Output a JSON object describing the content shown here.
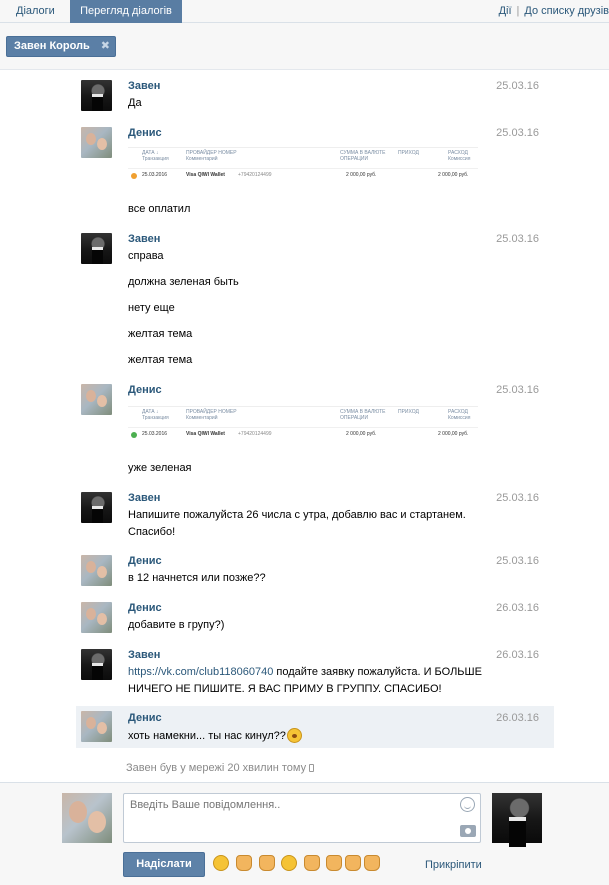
{
  "tabs": [
    "Діалоги",
    "Перегляд діалогів"
  ],
  "top_links": {
    "actions": "Дії",
    "separator": "|",
    "to_friends": "До списку друзів"
  },
  "filter_chip": {
    "label": "Завен Король",
    "close": "✖"
  },
  "messages": [
    {
      "author": "Завен",
      "date": "25.03.16",
      "lines": [
        "Да"
      ]
    },
    {
      "author": "Денис",
      "date": "25.03.16",
      "lines": [
        "все оплатил"
      ],
      "payment": {
        "h_date": "ДАТА ↓",
        "h_date2": "Транзакция",
        "h_provider": "ПРОВАЙДЕР НОМЕР",
        "h_provider2": "Комментарий",
        "h_sum": "СУММА В ВАЛЮТЕ",
        "h_sum2": "ОПЕРАЦИИ",
        "h_in": "ПРИХОД",
        "h_out": "РАСХОД",
        "h_out2": "Комиссия",
        "date": "25.03.2016",
        "provider": "Visa QIWI Wallet",
        "number": "+79420124499",
        "sum": "2 000,00 руб.",
        "out": "2 000,00 руб.",
        "status_color": "#f0a030"
      }
    },
    {
      "author": "Завен",
      "date": "25.03.16",
      "lines": [
        "справа",
        "должна зеленая быть",
        "нету еще",
        "желтая тема",
        "желтая тема"
      ]
    },
    {
      "author": "Денис",
      "date": "25.03.16",
      "lines": [
        "уже зеленая"
      ],
      "payment": {
        "h_date": "ДАТА ↓",
        "h_date2": "Транзакция",
        "h_provider": "ПРОВАЙДЕР НОМЕР",
        "h_provider2": "Комментарий",
        "h_sum": "СУММА В ВАЛЮТЕ",
        "h_sum2": "ОПЕРАЦИИ",
        "h_in": "ПРИХОД",
        "h_out": "РАСХОД",
        "h_out2": "Комиссия",
        "date": "25.03.2016",
        "provider": "Visa QIWI Wallet",
        "number": "+79420124499",
        "sum": "2 000,00 руб.",
        "out": "2 000,00 руб.",
        "status_color": "#4caf50"
      }
    },
    {
      "author": "Завен",
      "date": "25.03.16",
      "lines": [
        "Напишите пожалуйста 26 числа с утра, добавлю вас и стартанем.",
        "Спасибо!"
      ]
    },
    {
      "author": "Денис",
      "date": "25.03.16",
      "lines": [
        "в 12 начнется или позже??"
      ]
    },
    {
      "author": "Денис",
      "date": "26.03.16",
      "lines": [
        "добавите в групу?)"
      ]
    },
    {
      "author": "Завен",
      "date": "26.03.16",
      "link": "https://vk.com/club118060740",
      "link_rest": " подайте заявку пожалуйста. И БОЛЬШЕ",
      "lines": [
        "НИЧЕГО НЕ ПИШИТЕ. Я ВАС ПРИМУ В ГРУППУ. СПАСИБО!"
      ]
    },
    {
      "author": "Денис",
      "date": "26.03.16",
      "lines": [
        "хоть намекни... ты нас кинул??"
      ]
    }
  ],
  "status_line": "Завен був у мережі 20 хвилин тому",
  "composer": {
    "placeholder": "Введіть Ваше повідомлення..",
    "send_label": "Надіслати",
    "attach_label": "Прикріпити"
  },
  "quick_emoji": [
    "crying-face",
    "thumbs-up",
    "raised-hand",
    "grinning-face",
    "ok-hand",
    "flexed-biceps",
    "thumbs-up",
    "thumbs-down"
  ]
}
